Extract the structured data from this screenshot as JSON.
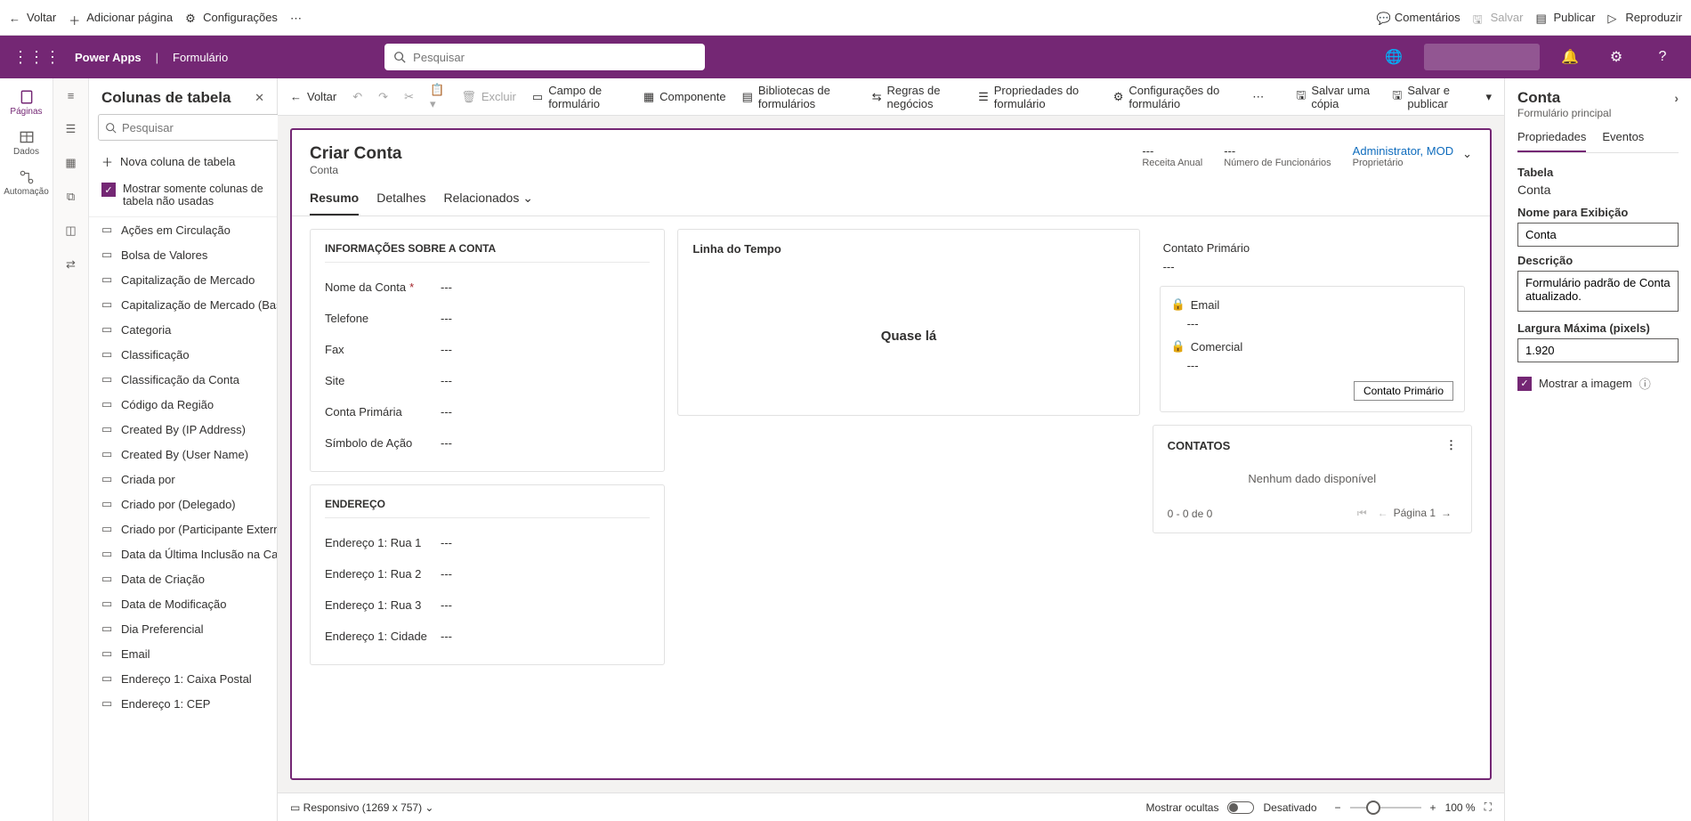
{
  "topBar": {
    "back": "Voltar",
    "addPage": "Adicionar página",
    "settings": "Configurações",
    "comments": "Comentários",
    "save": "Salvar",
    "publish": "Publicar",
    "play": "Reproduzir"
  },
  "header": {
    "brand": "Power Apps",
    "context": "Formulário",
    "searchPlaceholder": "Pesquisar"
  },
  "leftRail": {
    "pages": "Páginas",
    "data": "Dados",
    "automation": "Automação"
  },
  "cmd2": {
    "back": "Voltar",
    "delete": "Excluir",
    "formField": "Campo de formulário",
    "component": "Componente",
    "formLibs": "Bibliotecas de formulários",
    "bizRules": "Regras de negócios",
    "formProps": "Propriedades do formulário",
    "formSettings": "Configurações do formulário",
    "saveCopy": "Salvar uma cópia",
    "savePublish": "Salvar e publicar"
  },
  "colPanel": {
    "title": "Colunas de tabela",
    "searchPlaceholder": "Pesquisar",
    "newCol": "Nova coluna de tabela",
    "showUnused": "Mostrar somente colunas de tabela não usadas",
    "items": [
      "Ações em Circulação",
      "Bolsa de Valores",
      "Capitalização de Mercado",
      "Capitalização de Mercado (Base)",
      "Categoria",
      "Classificação",
      "Classificação da Conta",
      "Código da Região",
      "Created By (IP Address)",
      "Created By (User Name)",
      "Criada por",
      "Criado por (Delegado)",
      "Criado por (Participante Externo)",
      "Data da Última Inclusão na Camp...",
      "Data de Criação",
      "Data de Modificação",
      "Dia Preferencial",
      "Email",
      "Endereço 1: Caixa Postal",
      "Endereço 1: CEP"
    ]
  },
  "form": {
    "title": "Criar Conta",
    "entity": "Conta",
    "hdr": {
      "annualRevenue": {
        "v": "---",
        "l": "Receita Anual"
      },
      "employees": {
        "v": "---",
        "l": "Número de Funcionários"
      },
      "owner": {
        "v": "Administrator, MOD",
        "l": "Proprietário"
      }
    },
    "tabs": {
      "summary": "Resumo",
      "details": "Detalhes",
      "related": "Relacionados"
    },
    "sectionInfo": "INFORMAÇÕES SOBRE A CONTA",
    "fields": [
      {
        "l": "Nome da Conta",
        "v": "---",
        "req": true
      },
      {
        "l": "Telefone",
        "v": "---"
      },
      {
        "l": "Fax",
        "v": "---"
      },
      {
        "l": "Site",
        "v": "---"
      },
      {
        "l": "Conta Primária",
        "v": "---"
      },
      {
        "l": "Símbolo de Ação",
        "v": "---"
      }
    ],
    "sectionAddr": "ENDEREÇO",
    "addrFields": [
      {
        "l": "Endereço 1: Rua 1",
        "v": "---"
      },
      {
        "l": "Endereço 1: Rua 2",
        "v": "---"
      },
      {
        "l": "Endereço 1: Rua 3",
        "v": "---"
      },
      {
        "l": "Endereço 1: Cidade",
        "v": "---"
      }
    ],
    "timeline": {
      "title": "Linha do Tempo",
      "almost": "Quase lá"
    },
    "primaryContact": {
      "title": "Contato Primário",
      "val": "---",
      "email": "Email",
      "emailVal": "---",
      "biz": "Comercial",
      "bizVal": "---",
      "btn": "Contato Primário"
    },
    "contacts": {
      "title": "CONTATOS",
      "noData": "Nenhum dado disponível",
      "range": "0 - 0 de 0",
      "page": "Página 1"
    }
  },
  "statusBar": {
    "responsive": "Responsivo (1269 x 757)",
    "showHidden": "Mostrar ocultas",
    "deactivated": "Desativado",
    "zoom": "100 %"
  },
  "props": {
    "title": "Conta",
    "subtype": "Formulário principal",
    "tabProps": "Propriedades",
    "tabEvents": "Eventos",
    "tableLbl": "Tabela",
    "tableVal": "Conta",
    "dispNameLbl": "Nome para Exibição",
    "dispNameVal": "Conta",
    "descLbl": "Descrição",
    "descVal": "Formulário padrão de Conta atualizado.",
    "maxWidthLbl": "Largura Máxima (pixels)",
    "maxWidthVal": "1.920",
    "showImage": "Mostrar a imagem"
  }
}
